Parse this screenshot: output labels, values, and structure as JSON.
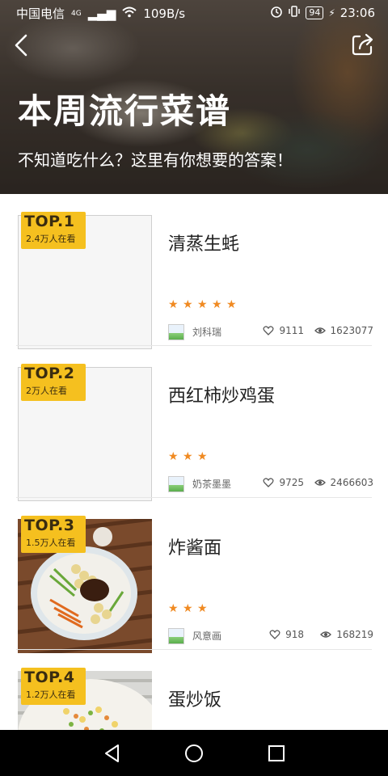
{
  "status_bar": {
    "carrier": "中国电信",
    "network": "4G",
    "speed": "109B/s",
    "battery": "94",
    "time": "23:06"
  },
  "header": {
    "back_icon": "chevron-left-icon",
    "share_icon": "share-icon",
    "title": "本周流行菜谱",
    "subtitle": "不知道吃什么？这里有你想要的答案！"
  },
  "recipes": [
    {
      "rank": "TOP.1",
      "viewers": "2.4万人在看",
      "name": "清蒸生蚝",
      "stars": 5,
      "author": "刘科瑞",
      "likes": "9111",
      "views": "1623077",
      "has_photo": false
    },
    {
      "rank": "TOP.2",
      "viewers": "2万人在看",
      "name": "西红柿炒鸡蛋",
      "stars": 3,
      "author": "奶茶墨墨",
      "likes": "9725",
      "views": "2466603",
      "has_photo": false
    },
    {
      "rank": "TOP.3",
      "viewers": "1.5万人在看",
      "name": "炸酱面",
      "stars": 3,
      "author": "风意画",
      "likes": "918",
      "views": "168219",
      "has_photo": true
    },
    {
      "rank": "TOP.4",
      "viewers": "1.2万人在看",
      "name": "蛋炒饭",
      "has_photo": true
    }
  ],
  "colors": {
    "badge": "#f5c01f",
    "star": "#f08a22",
    "navbar": "#000000"
  }
}
